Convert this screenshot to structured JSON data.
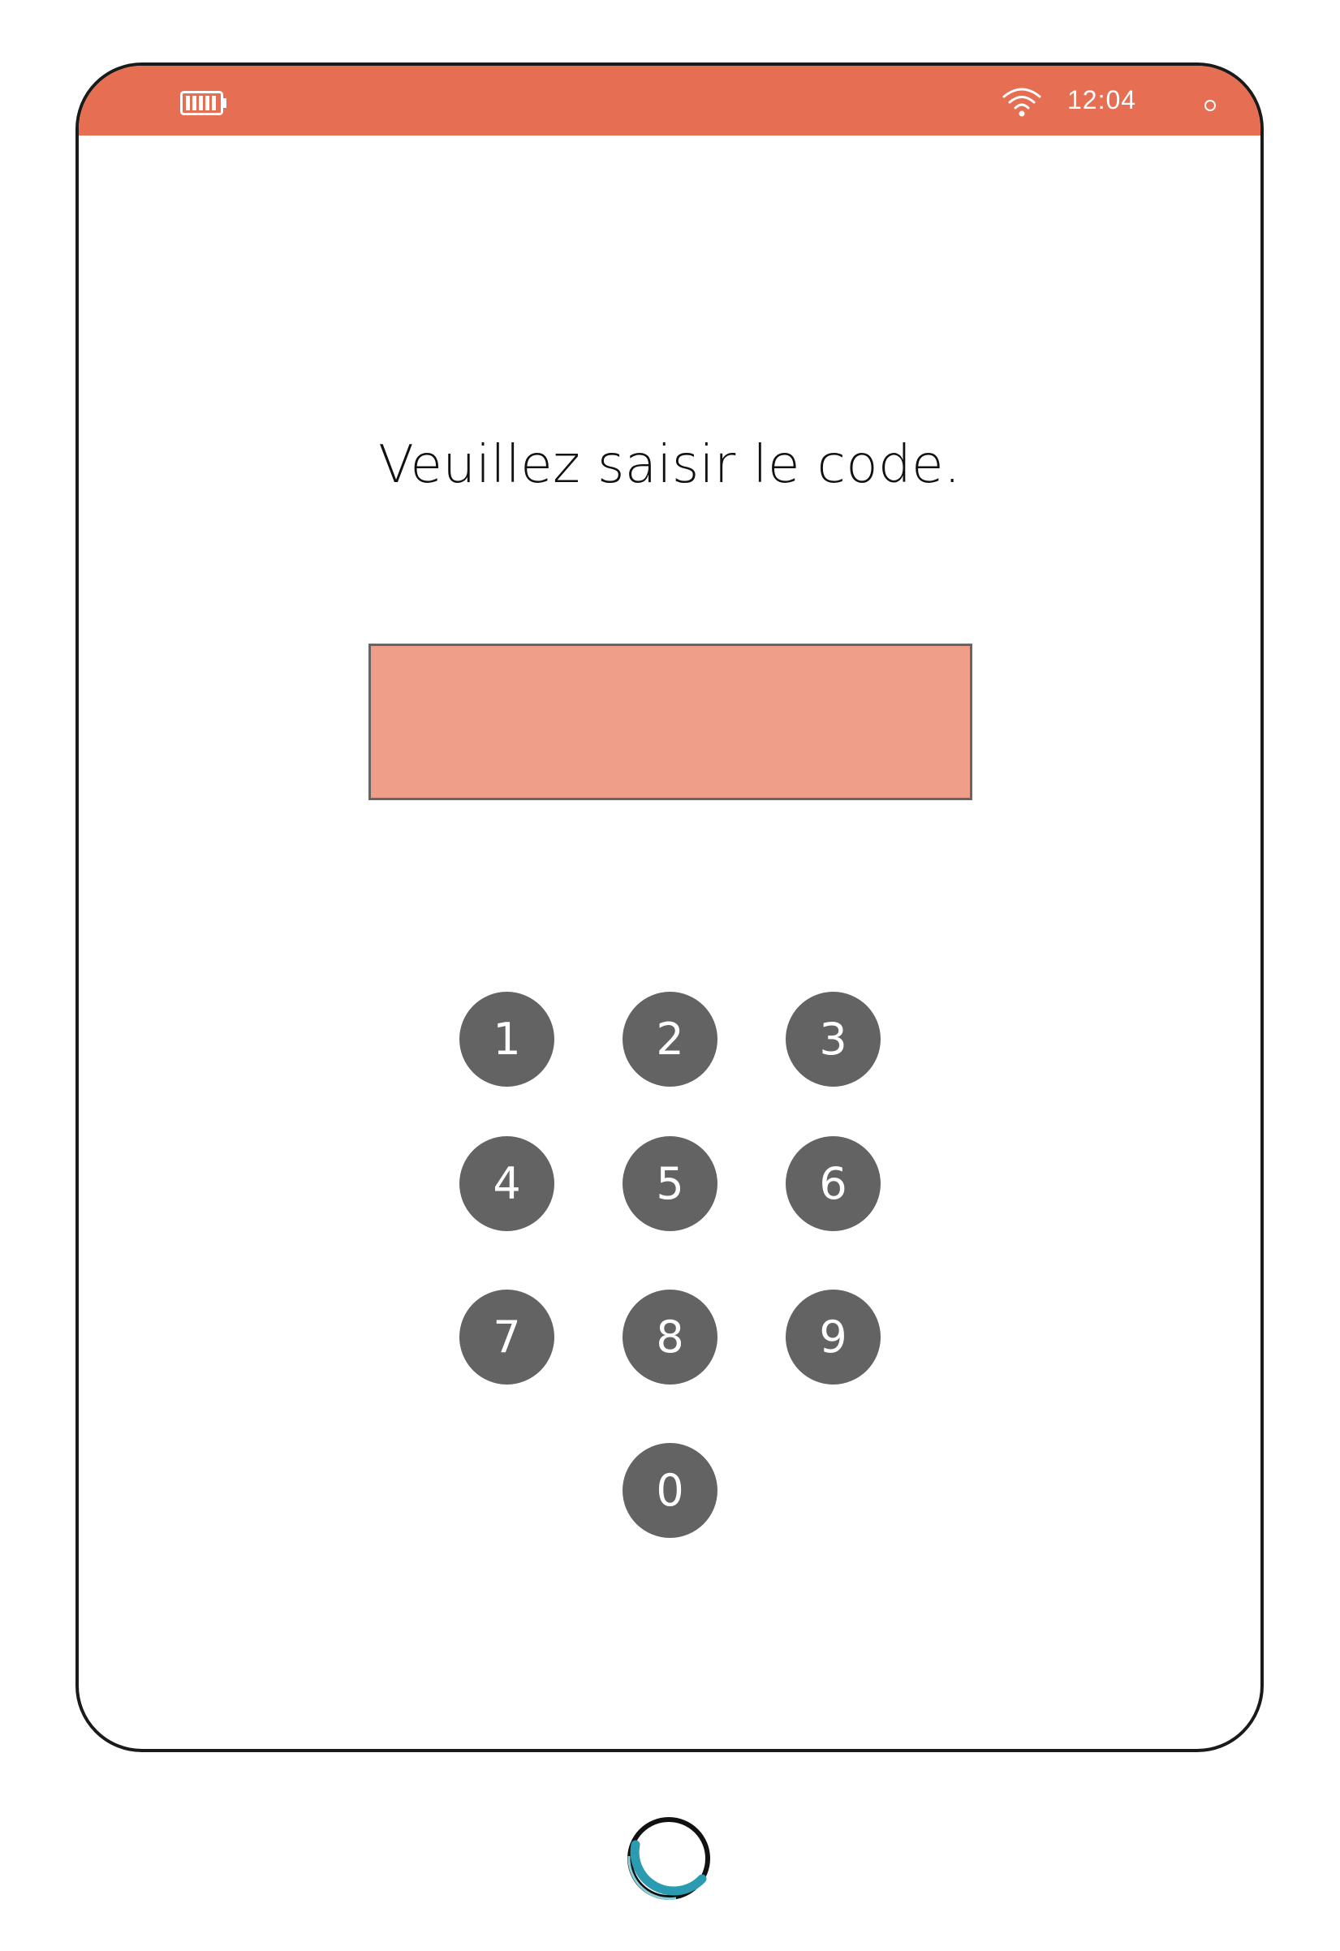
{
  "status_bar": {
    "time": "12:04",
    "battery_icon": "battery-full-icon",
    "wifi_icon": "wifi-icon",
    "background": "#e66f53"
  },
  "screen": {
    "prompt": "Veuillez saisir le code.",
    "code_value": "",
    "field_color": "#ee9e89"
  },
  "keypad": {
    "keys": [
      "1",
      "2",
      "3",
      "4",
      "5",
      "6",
      "7",
      "8",
      "9",
      "0"
    ],
    "key_color": "#636363"
  },
  "home_button": {
    "icon": "home-button-ring-icon",
    "accent": "#2a9bb0"
  }
}
